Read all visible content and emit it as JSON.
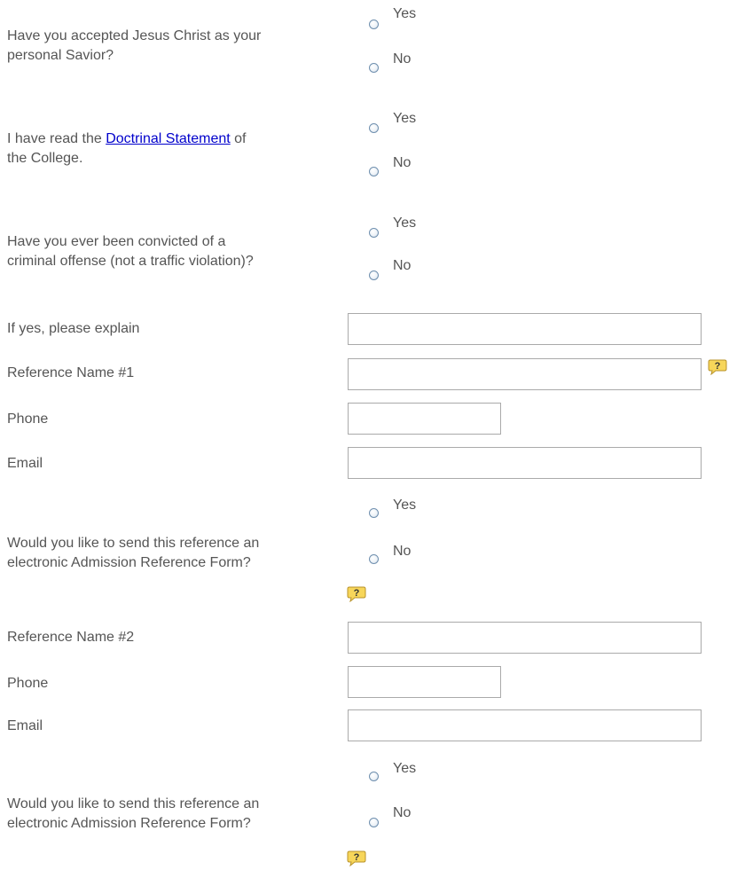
{
  "questions": {
    "q1": {
      "line1": "Have you accepted Jesus Christ as your",
      "line2": "personal Savior?",
      "yes": "Yes",
      "no": "No"
    },
    "q2": {
      "prefix": "I have read the ",
      "link": "Doctrinal Statement",
      "suffix": " of",
      "line2": "the College.",
      "yes": "Yes",
      "no": "No"
    },
    "q3": {
      "line1": "Have you ever been convicted of a",
      "line2": "criminal offense (not a traffic violation)?",
      "yes": "Yes",
      "no": "No"
    }
  },
  "explain": {
    "label": "If yes, please explain",
    "value": ""
  },
  "ref1": {
    "name_label": "Reference Name #1",
    "phone_label": "Phone",
    "email_label": "Email",
    "send_line1": "Would you like to send this reference an",
    "send_line2": "electronic Admission Reference Form?",
    "yes": "Yes",
    "no": "No"
  },
  "ref2": {
    "name_label": "Reference Name #2",
    "phone_label": "Phone",
    "email_label": "Email",
    "send_line1": "Would you like to send this reference an",
    "send_line2": "electronic Admission Reference Form?",
    "yes": "Yes",
    "no": "No"
  },
  "icons": {
    "help": "help-icon"
  },
  "colors": {
    "text": "#555555",
    "link": "#0000cc",
    "help_bg": "#f7d65a"
  }
}
